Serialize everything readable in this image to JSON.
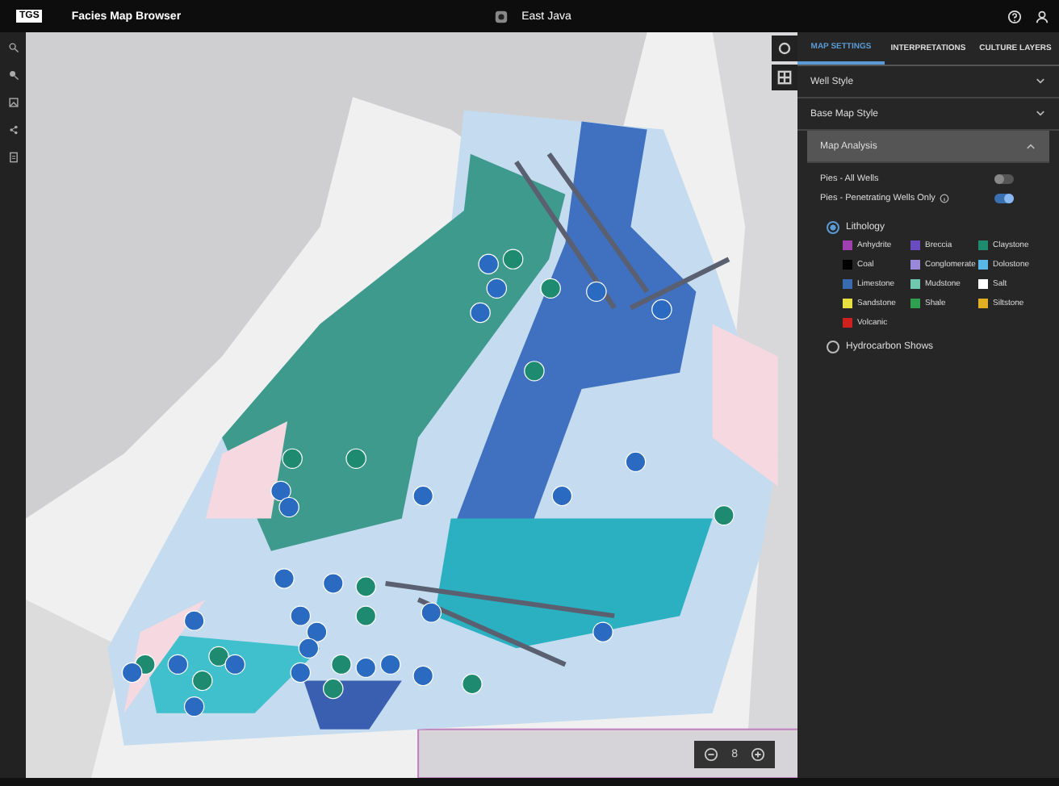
{
  "app": {
    "title": "Facies Map Browser",
    "logo": "TGS",
    "region": "East Java"
  },
  "tabs": [
    {
      "label": "MAP SETTINGS",
      "selected": true
    },
    {
      "label": "INTERPRETATIONS",
      "selected": false
    },
    {
      "label": "CULTURE LAYERS",
      "selected": false
    }
  ],
  "sections": [
    {
      "label": "Well Style",
      "expanded": false
    },
    {
      "label": "Base Map Style",
      "expanded": false
    },
    {
      "label": "Map Analysis",
      "expanded": true
    }
  ],
  "toggles": [
    {
      "label": "Pies - All Wells",
      "on": false,
      "info": false
    },
    {
      "label": "Pies - Penetrating Wells Only",
      "on": true,
      "info": true
    }
  ],
  "options": [
    {
      "label": "Lithology",
      "selected": true
    },
    {
      "label": "Hydrocarbon Shows",
      "selected": false
    }
  ],
  "legend": [
    {
      "label": "Anhydrite",
      "color": "#a040b0"
    },
    {
      "label": "Breccia",
      "color": "#6a4cc0"
    },
    {
      "label": "Claystone",
      "color": "#1e8a70"
    },
    {
      "label": "Coal",
      "color": "#000000"
    },
    {
      "label": "Conglomerate",
      "color": "#9a88d8"
    },
    {
      "label": "Dolostone",
      "color": "#5ab8e8"
    },
    {
      "label": "Limestone",
      "color": "#3a6ab0"
    },
    {
      "label": "Mudstone",
      "color": "#70c8b0"
    },
    {
      "label": "Salt",
      "color": "#ffffff"
    },
    {
      "label": "Sandstone",
      "color": "#e8e040"
    },
    {
      "label": "Shale",
      "color": "#30a050"
    },
    {
      "label": "Siltstone",
      "color": "#e0b020"
    },
    {
      "label": "Volcanic",
      "color": "#d02020"
    }
  ],
  "zoom": {
    "level": "8"
  }
}
